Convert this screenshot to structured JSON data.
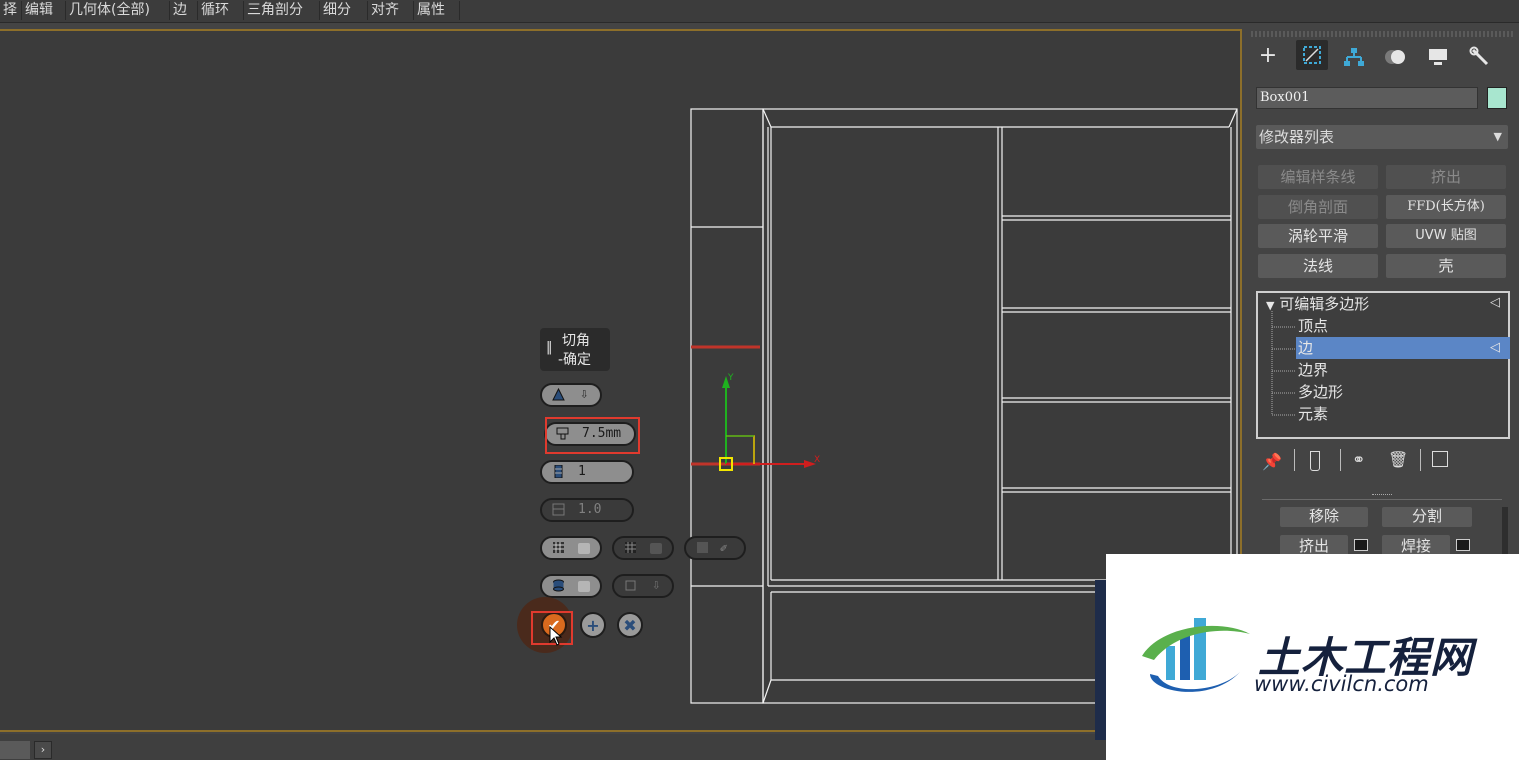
{
  "ribbon": {
    "tabs": [
      "择",
      "编辑",
      "几何体(全部)",
      "边",
      "循环",
      "三角剖分",
      "细分",
      "对齐",
      "属性"
    ]
  },
  "caddy": {
    "title_line1": "切角",
    "title_line2": "-确定",
    "amount": "7.5mm",
    "segments": "1",
    "tension": "1.0",
    "collapse_icon": "‖"
  },
  "gizmo": {
    "y_label": "Y",
    "x_label": "X"
  },
  "panel": {
    "object_name": "Box001",
    "object_color": "#a8e6cf",
    "modifier_list": "修改器列表",
    "buttons": [
      {
        "label": "编辑样条线",
        "enabled": false
      },
      {
        "label": "挤出",
        "enabled": false
      },
      {
        "label": "倒角剖面",
        "enabled": false
      },
      {
        "label": "FFD(长方体)",
        "enabled": true
      },
      {
        "label": "涡轮平滑",
        "enabled": true
      },
      {
        "label": "UVW 贴图",
        "enabled": true
      },
      {
        "label": "法线",
        "enabled": true
      },
      {
        "label": "壳",
        "enabled": true
      }
    ],
    "stack": {
      "root": "可编辑多边形",
      "items": [
        "顶点",
        "边",
        "边界",
        "多边形",
        "元素"
      ],
      "selected": "边"
    },
    "sub_buttons": {
      "remove": "移除",
      "split": "分割",
      "extrude": "挤出",
      "weld": "焊接"
    }
  },
  "watermark": {
    "cn": "土木工程网",
    "url": "www.civilcn.com"
  },
  "colors": {
    "highlight": "#e03a2e",
    "selection": "#5b86c6",
    "viewport_border": "#8d6f2a"
  }
}
